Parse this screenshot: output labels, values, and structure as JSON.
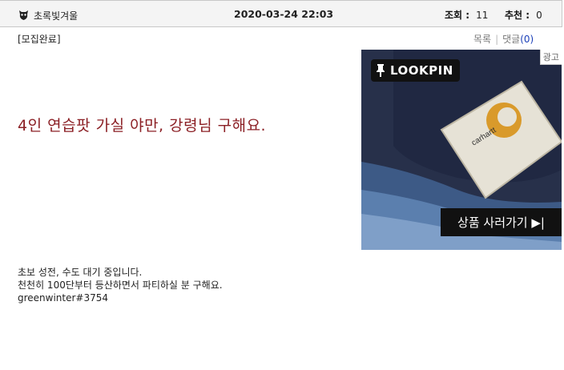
{
  "post": {
    "author": "초록빛겨울",
    "author_icon": "character-avatar-icon",
    "datetime": "2020-03-24 22:03",
    "views_label": "조회 :",
    "views": "11",
    "recs_label": "추천 :",
    "recs": "0",
    "status_tag": "[모집완료]",
    "list_link": "목록",
    "comments_link": "댓글",
    "comments_count": "(0)",
    "headline": "4인 연습팟 가실 야만, 강령님 구해요.",
    "body_lines": [
      "초보 성전, 수도 대기 중입니다.",
      "천천히 100단부터 등산하면서 파티하실 분 구해요.",
      "",
      "greenwinter#3754"
    ]
  },
  "ad": {
    "tag": "광고",
    "brand": "LOOKPIN",
    "brand_icon": "pin-icon",
    "label_text": "carhartt",
    "cta": "상품 사러가기 ▶|",
    "colors": {
      "headline": "#8b1f24",
      "link_count": "#1a3fb8"
    }
  }
}
